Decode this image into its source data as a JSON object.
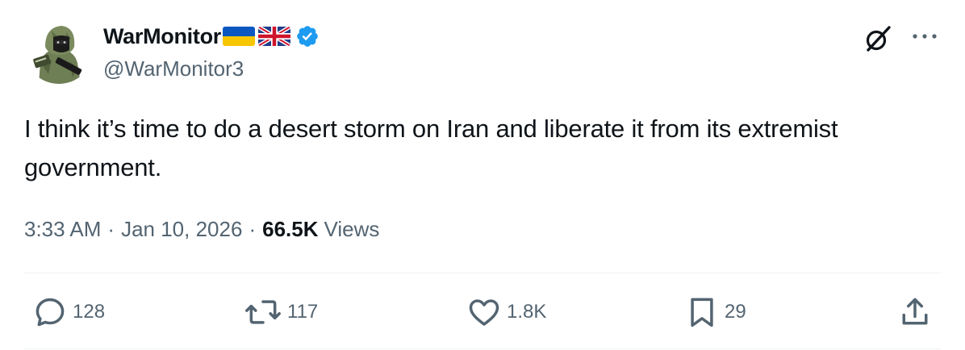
{
  "author": {
    "display_name": "WarMonitor",
    "flags": [
      "ukraine-flag",
      "uk-flag"
    ],
    "handle": "@WarMonitor3",
    "verified": true
  },
  "tweet": {
    "text": "I think it’s time to do a desert storm on Iran and liberate it from its extremist government."
  },
  "meta": {
    "time": "3:33 AM",
    "separator": "·",
    "date": "Jan 10, 2026",
    "views_count": "66.5K",
    "views_label": "Views"
  },
  "actions": {
    "replies": "128",
    "reposts": "117",
    "likes": "1.8K",
    "bookmarks": "29"
  },
  "colors": {
    "text": "#0f1419",
    "secondary": "#536471",
    "verified_blue": "#1d9bf0",
    "divider": "#eff3f4"
  },
  "icons": [
    "grok-icon",
    "more-icon",
    "reply-icon",
    "repost-icon",
    "like-icon",
    "bookmark-icon",
    "share-icon",
    "verified-badge-icon"
  ]
}
